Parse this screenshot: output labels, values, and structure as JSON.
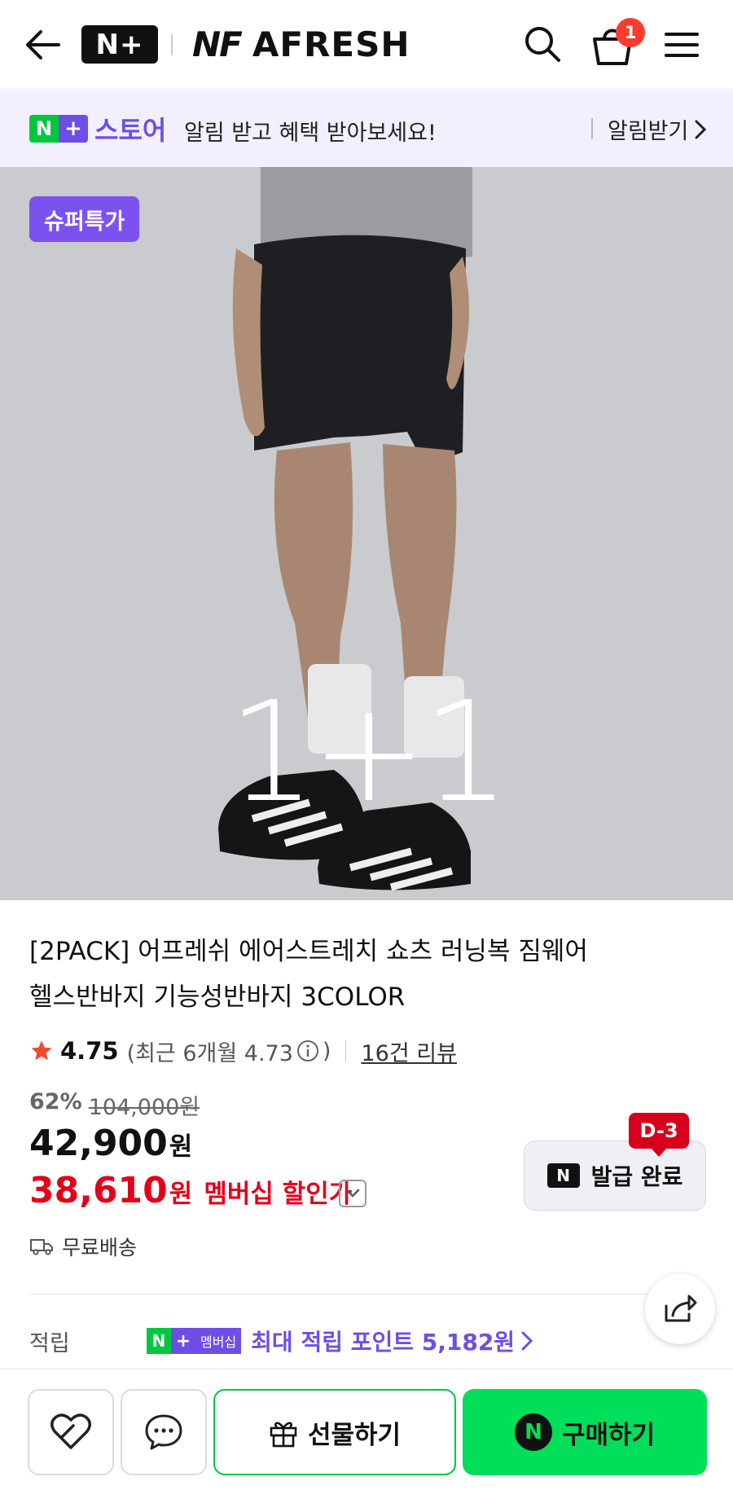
{
  "header": {
    "naver_plus_badge": "N+",
    "brand_mark": "NF",
    "brand_name": "AFRESH",
    "cart_count": "1"
  },
  "alert_banner": {
    "store_n": "N",
    "store_plus": "+",
    "store_label": "스토어",
    "message": "알림 받고 혜택 받아보세요!",
    "action_label": "알림받기"
  },
  "product_image": {
    "badge": "슈퍼특가",
    "promo_text": "1+1"
  },
  "product": {
    "title_line1": "[2PACK] 어프레쉬 에어스트레치 쇼츠 러닝복 짐웨어",
    "title_line2": "헬스반바지 기능성반바지 3COLOR",
    "rating": "4.75",
    "recent_rating": "(최근 6개월 4.73",
    "recent_rating_close": ")",
    "review_count": "16건 리뷰",
    "discount_rate": "62%",
    "original_price": "104,000원",
    "price_amount": "42,900",
    "price_unit": "원",
    "member_price_amount": "38,610",
    "member_price_unit": "원",
    "member_price_label": "멤버십 할인가",
    "shipping": "무료배송"
  },
  "coupon": {
    "deadline": "D-3",
    "n_icon": "N",
    "label": "발급 완료"
  },
  "points": {
    "label": "적립",
    "badge_n": "N",
    "badge_plus": "+",
    "badge_text": "멤버십",
    "text": "최대 적립 포인트 5,182원"
  },
  "bottom_bar": {
    "gift_label": "선물하기",
    "buy_n": "N",
    "buy_label": "구매하기"
  },
  "colors": {
    "naver_green": "#00c73c",
    "plus_purple": "#6e4ee6",
    "member_red": "#e3001b",
    "buy_green": "#00de5a"
  }
}
